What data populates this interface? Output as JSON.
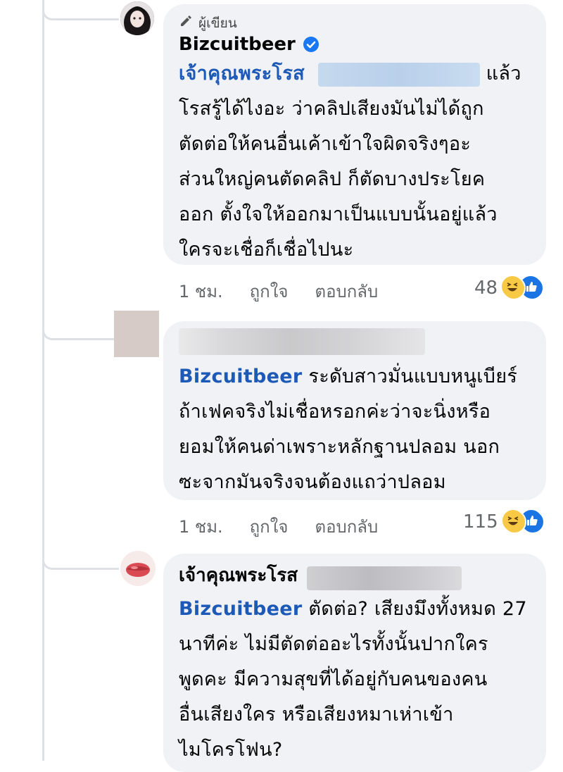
{
  "comment1": {
    "badge": "ผู้เขียน",
    "author": "Bizcuitbeer",
    "mention": "เจ้าคุณพระโรส",
    "first_line_tail": "แล้ว",
    "lines": [
      "โรสรู้ได้ไงอะ ว่าคลิปเสียงมันไม่ได้ถูก",
      "ตัดต่อให้คนอื่นเค้าเข้าใจผิดจริงๆอะ",
      "ส่วนใหญ่คนตัดคลิป ก็ตัดบางประโยค",
      "ออก ตั้งใจให้ออกมาเป็นแบบนั้นอยู่แล้ว",
      "ใครจะเชื่อก็เชื่อไปนะ"
    ],
    "time": "1 ชม.",
    "like": "ถูกใจ",
    "reply": "ตอบกลับ",
    "reaction_count": "48"
  },
  "comment2": {
    "mention": "Bizcuitbeer",
    "first_line_tail": "ระดับสาวมั่นแบบหนูเบียร์",
    "lines": [
      "ถ้าเฟคจริงไม่เชื่อหรอกค่ะว่าจะนิ่งหรือ",
      "ยอมให้คนด่าเพราะหลักฐานปลอม นอก",
      "ซะจากมันจริงจนต้องแถว่าปลอม"
    ],
    "time": "1 ชม.",
    "like": "ถูกใจ",
    "reply": "ตอบกลับ",
    "reaction_count": "115"
  },
  "comment3": {
    "author": "เจ้าคุณพระโรส",
    "mention": "Bizcuitbeer",
    "first_line_tail": "ตัดต่อ? เสียงมึงทั้งหมด 27",
    "lines": [
      "นาทีค่ะ ไม่มีตัดต่ออะไรทั้งนั้นปากใคร",
      "พูดคะ มีความสุขที่ได้อยู่กับคนของคน",
      "อื่นเสียงใคร หรือเสียงหมาเห่าเข้า",
      "ไมโครโฟน?"
    ]
  },
  "icons": {
    "pencil": "pencil-icon",
    "verified": "verified-badge-icon",
    "haha": "haha-reaction-icon",
    "like": "like-reaction-icon"
  },
  "colors": {
    "mention": "#1d59b7",
    "bubble": "#f0f2f5",
    "meta": "#65676b",
    "verified": "#1877f2"
  }
}
